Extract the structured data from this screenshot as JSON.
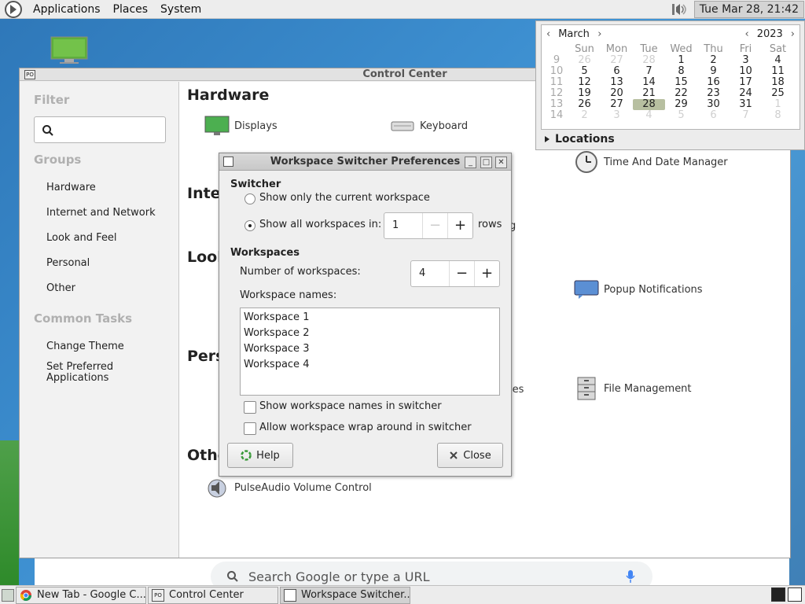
{
  "top_panel": {
    "menus": [
      "Applications",
      "Places",
      "System"
    ],
    "clock": "Tue Mar 28, 21:42",
    "volume_icon": "speaker-icon"
  },
  "control_center": {
    "title": "Control Center",
    "filter_heading": "Filter",
    "groups_heading": "Groups",
    "groups": [
      "Hardware",
      "Internet and Network",
      "Look and Feel",
      "Personal",
      "Other"
    ],
    "common_tasks_heading": "Common Tasks",
    "common_tasks": [
      "Change Theme",
      "Set Preferred Applications"
    ],
    "sections": {
      "hardware": "Hardware",
      "internet": "Internet and Network",
      "look": "Look and Feel",
      "personal": "Personal",
      "other": "Other"
    },
    "items": {
      "displays": "Displays",
      "keyboard": "Keyboard",
      "time_date": "Time And Date Manager",
      "popup_notifications": "Popup Notifications",
      "file_management": "File Management",
      "pulseaudio": "PulseAudio Volume Control",
      "partial_g": "g",
      "partial_ies": "ies"
    }
  },
  "calendar": {
    "month": "March",
    "year": "2023",
    "weekdays": [
      "Sun",
      "Mon",
      "Tue",
      "Wed",
      "Thu",
      "Fri",
      "Sat"
    ],
    "weeks": [
      {
        "wk": "9",
        "days": [
          "26",
          "27",
          "28",
          "1",
          "2",
          "3",
          "4"
        ],
        "dim": [
          true,
          true,
          true,
          false,
          false,
          false,
          false
        ]
      },
      {
        "wk": "10",
        "days": [
          "5",
          "6",
          "7",
          "8",
          "9",
          "10",
          "11"
        ],
        "dim": [
          false,
          false,
          false,
          false,
          false,
          false,
          false
        ]
      },
      {
        "wk": "11",
        "days": [
          "12",
          "13",
          "14",
          "15",
          "16",
          "17",
          "18"
        ],
        "dim": [
          false,
          false,
          false,
          false,
          false,
          false,
          false
        ]
      },
      {
        "wk": "12",
        "days": [
          "19",
          "20",
          "21",
          "22",
          "23",
          "24",
          "25"
        ],
        "dim": [
          false,
          false,
          false,
          false,
          false,
          false,
          false
        ]
      },
      {
        "wk": "13",
        "days": [
          "26",
          "27",
          "28",
          "29",
          "30",
          "31",
          "1"
        ],
        "dim": [
          false,
          false,
          false,
          false,
          false,
          false,
          true
        ]
      },
      {
        "wk": "14",
        "days": [
          "2",
          "3",
          "4",
          "5",
          "6",
          "7",
          "8"
        ],
        "dim": [
          true,
          true,
          true,
          true,
          true,
          true,
          true
        ]
      }
    ],
    "today": "28",
    "locations_label": "Locations"
  },
  "workspace_dialog": {
    "title": "Workspace Switcher Preferences",
    "switcher_heading": "Switcher",
    "option_current": "Show only the current workspace",
    "option_all": "Show all workspaces in:",
    "selected_option": "all",
    "rows_value": "1",
    "rows_label": "rows",
    "workspaces_heading": "Workspaces",
    "number_label": "Number of workspaces:",
    "number_value": "4",
    "names_label": "Workspace names:",
    "names": [
      "Workspace 1",
      "Workspace 2",
      "Workspace 3",
      "Workspace 4"
    ],
    "check_names": "Show workspace names in switcher",
    "check_wrap": "Allow workspace wrap around in switcher",
    "help_label": "Help",
    "close_label": "Close"
  },
  "chrome": {
    "search_placeholder": "Search Google or type a URL"
  },
  "taskbar": {
    "tasks": [
      "New Tab - Google C...",
      "Control Center",
      "Workspace Switcher..."
    ]
  }
}
